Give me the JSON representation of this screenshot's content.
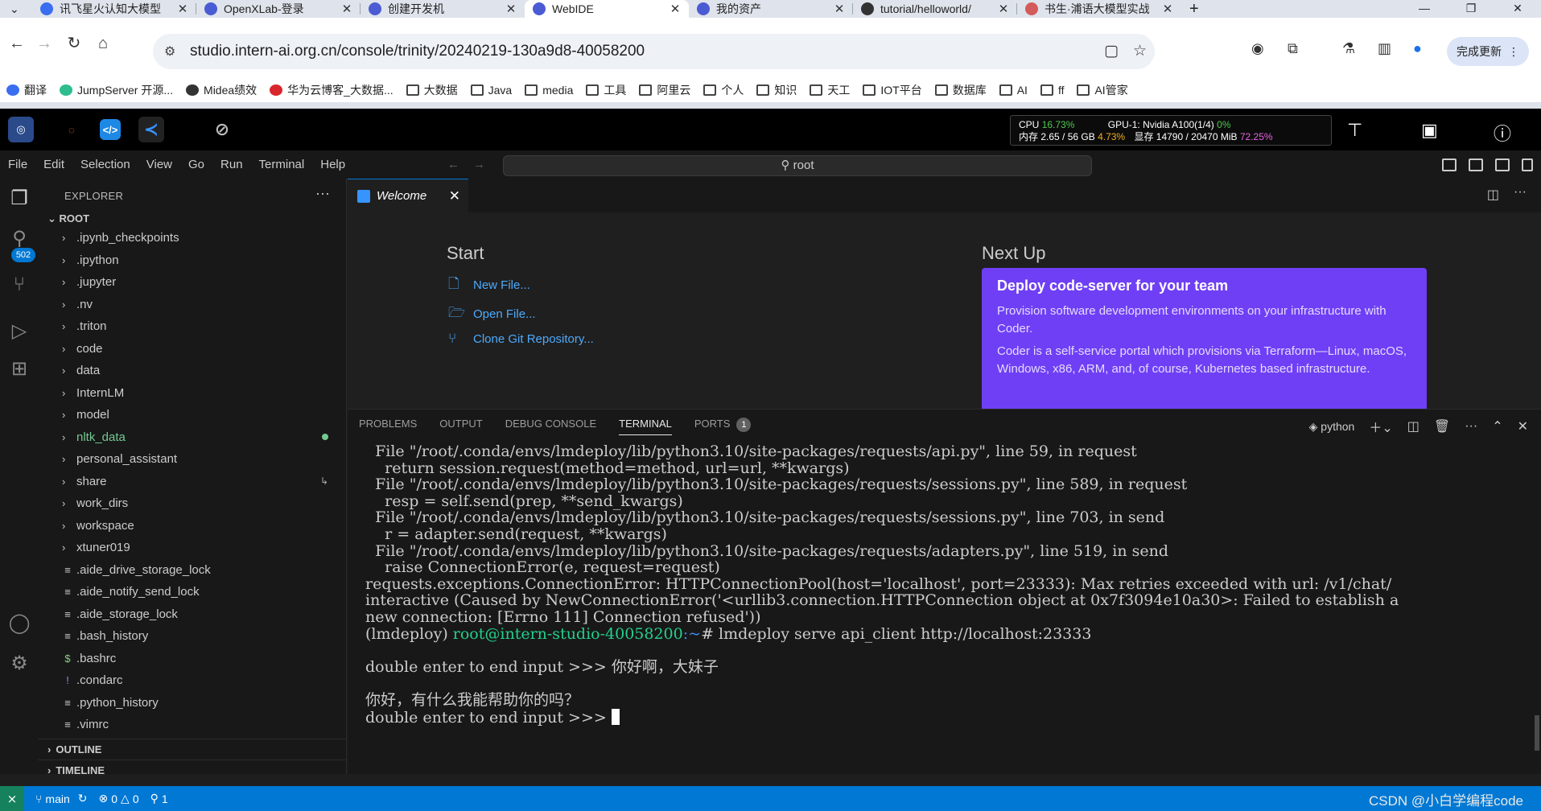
{
  "browser": {
    "tabs": [
      {
        "label": "讯飞星火认知大模型",
        "color": "#3a6df0"
      },
      {
        "label": "OpenXLab-登录",
        "color": "#4a5bd4"
      },
      {
        "label": "创建开发机",
        "color": "#4a5bd4"
      },
      {
        "label": "WebIDE",
        "color": "#4a5bd4"
      },
      {
        "label": "我的资产",
        "color": "#4a5bd4"
      },
      {
        "label": "tutorial/helloworld/",
        "color": "#333"
      },
      {
        "label": "书生·浦语大模型实战",
        "color": "#d45b5b"
      }
    ],
    "new_tab": "+",
    "url": "studio.intern-ai.org.cn/console/trinity/20240219-130a9d8-40058200",
    "update_button": "完成更新",
    "bookmarks": [
      {
        "label": "翻译",
        "icon": "translate-icon"
      },
      {
        "label": "JumpServer 开源...",
        "icon": "jumpserver-icon"
      },
      {
        "label": "Midea绩效",
        "icon": "globe-icon"
      },
      {
        "label": "华为云博客_大数据...",
        "icon": "huawei-icon"
      },
      {
        "label": "大数据",
        "icon": "folder-icon"
      },
      {
        "label": "Java",
        "icon": "folder-icon"
      },
      {
        "label": "media",
        "icon": "folder-icon"
      },
      {
        "label": "工具",
        "icon": "folder-icon"
      },
      {
        "label": "阿里云",
        "icon": "folder-icon"
      },
      {
        "label": "个人",
        "icon": "folder-icon"
      },
      {
        "label": "知识",
        "icon": "folder-icon"
      },
      {
        "label": "天工",
        "icon": "folder-icon"
      },
      {
        "label": "IOT平台",
        "icon": "folder-icon"
      },
      {
        "label": "数据库",
        "icon": "folder-icon"
      },
      {
        "label": "AI",
        "icon": "folder-icon"
      },
      {
        "label": "ff",
        "icon": "folder-icon"
      },
      {
        "label": "AI管家",
        "icon": "folder-icon"
      }
    ]
  },
  "stats": {
    "cpu_label": "CPU",
    "cpu_value": "16.73%",
    "mem_label": "内存 2.65 / 56 GB",
    "mem_value": "4.73%",
    "gpu_label": "GPU-1: Nvidia A100(1/4)",
    "gpu_value": "0%",
    "vram_label": "显存 14790 / 20470 MiB",
    "vram_value": "72.25%"
  },
  "menu": [
    "File",
    "Edit",
    "Selection",
    "View",
    "Go",
    "Run",
    "Terminal",
    "Help"
  ],
  "search": {
    "text": "root"
  },
  "activity": {
    "scm_badge": "502"
  },
  "explorer": {
    "title": "EXPLORER",
    "root": "ROOT",
    "folders": [
      ".ipynb_checkpoints",
      ".ipython",
      ".jupyter",
      ".nv",
      ".triton",
      "code",
      "data",
      "InternLM",
      "model",
      "nltk_data",
      "personal_assistant",
      "share",
      "work_dirs",
      "workspace",
      "xtuner019"
    ],
    "files": [
      {
        "name": ".aide_drive_storage_lock",
        "icon": "≡"
      },
      {
        "name": ".aide_notify_send_lock",
        "icon": "≡"
      },
      {
        "name": ".aide_storage_lock",
        "icon": "≡"
      },
      {
        "name": ".bash_history",
        "icon": "≡"
      },
      {
        "name": ".bashrc",
        "icon": "$"
      },
      {
        "name": ".condarc",
        "icon": "!"
      },
      {
        "name": ".python_history",
        "icon": "≡"
      },
      {
        "name": ".vimrc",
        "icon": "≡"
      }
    ],
    "outline": "OUTLINE",
    "timeline": "TIMELINE"
  },
  "editor": {
    "tab_label": "Welcome",
    "start_heading": "Start",
    "links": [
      "New File...",
      "Open File...",
      "Clone Git Repository..."
    ],
    "next_heading": "Next Up",
    "card_title": "Deploy code-server for your team",
    "card_p1": "Provision software development environments on your infrastructure with Coder.",
    "card_p2": "Coder is a self-service portal which provisions via Terraform—Linux, macOS, Windows, x86, ARM, and, of course, Kubernetes based infrastructure."
  },
  "panel": {
    "tabs": [
      "PROBLEMS",
      "OUTPUT",
      "DEBUG CONSOLE",
      "TERMINAL",
      "PORTS"
    ],
    "ports_count": "1",
    "shell": "python"
  },
  "terminal": {
    "lines": [
      "  File \"/root/.conda/envs/lmdeploy/lib/python3.10/site-packages/requests/api.py\", line 59, in request",
      "    return session.request(method=method, url=url, **kwargs)",
      "  File \"/root/.conda/envs/lmdeploy/lib/python3.10/site-packages/requests/sessions.py\", line 589, in request",
      "    resp = self.send(prep, **send_kwargs)",
      "  File \"/root/.conda/envs/lmdeploy/lib/python3.10/site-packages/requests/sessions.py\", line 703, in send",
      "    r = adapter.send(request, **kwargs)",
      "  File \"/root/.conda/envs/lmdeploy/lib/python3.10/site-packages/requests/adapters.py\", line 519, in send",
      "    raise ConnectionError(e, request=request)",
      "requests.exceptions.ConnectionError: HTTPConnectionPool(host='localhost', port=23333): Max retries exceeded with url: /v1/chat/",
      "interactive (Caused by NewConnectionError('<urllib3.connection.HTTPConnection object at 0x7f3094e10a30>: Failed to establish a",
      "new connection: [Errno 111] Connection refused'))"
    ],
    "prompt_env": "(lmdeploy) ",
    "prompt_user": "root@intern-studio-40058200",
    "prompt_path": ":~",
    "prompt_cmd": "# lmdeploy serve api_client http://localhost:23333",
    "input_prompt_1": "double enter to end input >>> 你好啊，大妹子",
    "response": "你好，有什么我能帮助你的吗？",
    "input_prompt_2": "double enter to end input >>> "
  },
  "status": {
    "branch": "main",
    "errors": "0",
    "warnings": "0",
    "ports": "1",
    "watermark": "CSDN @小白学编程code"
  }
}
